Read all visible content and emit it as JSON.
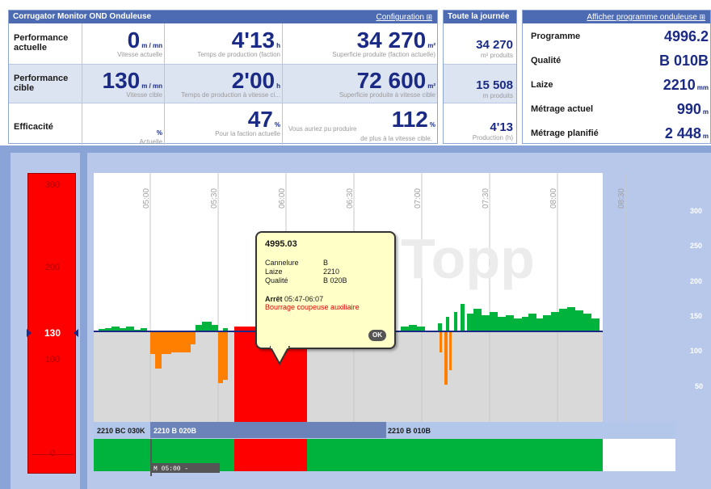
{
  "header": {
    "title": "Corrugator Monitor OND Onduleuse",
    "config_link": "Configuration",
    "day_title": "Toute la journée",
    "program_link": "Afficher programme onduleuse"
  },
  "kpi": {
    "rows": [
      {
        "label": "Performance actuelle",
        "speed": {
          "value": "0",
          "unit": "m / mn",
          "sub": "Vitesse actuelle"
        },
        "time": {
          "value": "4'13",
          "unit": "h",
          "sub": "Temps de production (faction"
        },
        "area": {
          "value": "34 270",
          "unit": "m²",
          "sub": "Superficie produite (faction actuelle)"
        }
      },
      {
        "label": "Performance cible",
        "speed": {
          "value": "130",
          "unit": "m / mn",
          "sub": "Vitesse cible"
        },
        "time": {
          "value": "2'00",
          "unit": "h",
          "sub": "Temps de production à vitesse ci..."
        },
        "area": {
          "value": "72 600",
          "unit": "m²",
          "sub": "Superficie produite à vitesse cible"
        }
      },
      {
        "label": "Efficacité",
        "speed": {
          "value": "",
          "unit": "%",
          "sub": "Actuelle"
        },
        "time": {
          "value": "47",
          "unit": "%",
          "sub": "Pour la faction actuelle"
        },
        "area": {
          "value": "112",
          "unit": "%",
          "sub_a": "Vous auriez pu produire",
          "sub_b": "de plus à la vitesse cible."
        }
      }
    ]
  },
  "day": {
    "area": {
      "value": "34 270",
      "sub": "m² produits"
    },
    "length": {
      "value": "15 508",
      "sub": "m produits"
    },
    "time": {
      "value": "4'13",
      "sub": "Production (h)"
    }
  },
  "program": {
    "rows": [
      {
        "label": "Programme",
        "value": "4996.2",
        "unit": ""
      },
      {
        "label": "Qualité",
        "value": "B 010B",
        "unit": ""
      },
      {
        "label": "Laize",
        "value": "2210",
        "unit": "mm"
      },
      {
        "label": "Métrage actuel",
        "value": "990",
        "unit": "m"
      },
      {
        "label": "Métrage planifié",
        "value": "2 448",
        "unit": "m"
      }
    ]
  },
  "gauge": {
    "ticks": [
      "300",
      "200",
      "100",
      "0"
    ],
    "marker": "130",
    "fill_color": "#ff0000"
  },
  "chart": {
    "time_ticks": [
      "05:00",
      "05:30",
      "06:00",
      "06:30",
      "07:00",
      "07:30",
      "08:00",
      "08:30"
    ],
    "right_ticks": [
      "300",
      "250",
      "200",
      "150",
      "100",
      "50"
    ],
    "watermark": "Topp",
    "jobs": [
      "2210 BC 030K",
      "2210 B 020B",
      "2210 B 010B"
    ],
    "marker_label": "M 05:00 -",
    "colors": {
      "run": "#00b33c",
      "below": "#ff8000",
      "stop": "#ff0000",
      "target": "#1a2a85",
      "bg": "#d9d9d9"
    }
  },
  "tooltip": {
    "title": "4995.03",
    "fields": [
      {
        "k": "Cannelure",
        "v": "B"
      },
      {
        "k": "Laize",
        "v": "2210"
      },
      {
        "k": "Qualité",
        "v": "B 020B"
      }
    ],
    "stop_label": "Arrêt",
    "stop_time": "05:47-06:07",
    "reason": "Bourrage coupeuse auxiliaire",
    "ok": "OK"
  }
}
